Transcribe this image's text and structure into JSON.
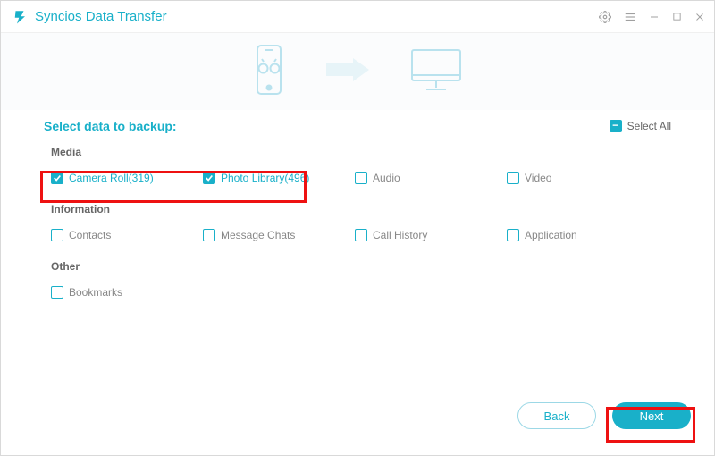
{
  "title": "Syncios Data Transfer",
  "prompt": "Select data to backup:",
  "select_all_label": "Select All",
  "sections": {
    "media": {
      "header": "Media",
      "items": {
        "camera_roll": {
          "label": "Camera Roll(319)",
          "checked": true
        },
        "photo_library": {
          "label": "Photo Library(496)",
          "checked": true
        },
        "audio": {
          "label": "Audio",
          "checked": false
        },
        "video": {
          "label": "Video",
          "checked": false
        }
      }
    },
    "information": {
      "header": "Information",
      "items": {
        "contacts": {
          "label": "Contacts",
          "checked": false
        },
        "message_chats": {
          "label": "Message Chats",
          "checked": false
        },
        "call_history": {
          "label": "Call History",
          "checked": false
        },
        "application": {
          "label": "Application",
          "checked": false
        }
      }
    },
    "other": {
      "header": "Other",
      "items": {
        "bookmarks": {
          "label": "Bookmarks",
          "checked": false
        }
      }
    }
  },
  "footer": {
    "back": "Back",
    "next": "Next"
  },
  "icons": {
    "settings": "gear-icon",
    "menu": "menu-icon",
    "minimize": "minimize-icon",
    "maximize": "maximize-icon",
    "close": "close-icon",
    "source_device": "phone-android-icon",
    "arrow": "arrow-right-icon",
    "target_device": "monitor-icon"
  }
}
